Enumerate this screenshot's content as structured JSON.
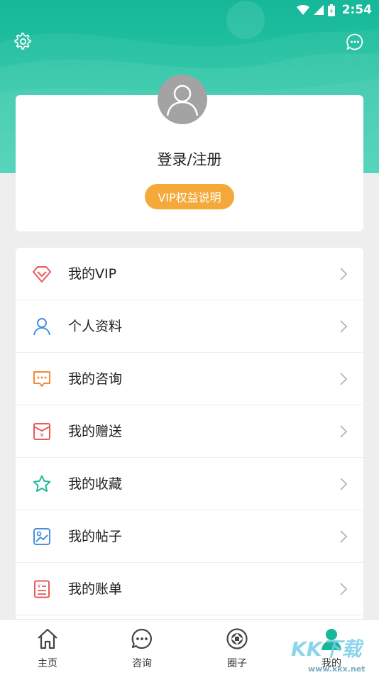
{
  "status_bar": {
    "time": "2:54"
  },
  "profile": {
    "login_label": "登录/注册",
    "vip_button": "VIP权益说明"
  },
  "menu": {
    "items": [
      {
        "label": "我的VIP",
        "icon": "diamond-icon",
        "color": "#e85a5a"
      },
      {
        "label": "个人资料",
        "icon": "person-icon",
        "color": "#4a90e2"
      },
      {
        "label": "我的咨询",
        "icon": "chat-icon",
        "color": "#f08c3c"
      },
      {
        "label": "我的赠送",
        "icon": "gift-envelope-icon",
        "color": "#e85a5a"
      },
      {
        "label": "我的收藏",
        "icon": "star-icon",
        "color": "#22b89a"
      },
      {
        "label": "我的帖子",
        "icon": "image-post-icon",
        "color": "#4a90e2"
      },
      {
        "label": "我的账单",
        "icon": "bill-icon",
        "color": "#e85a5a"
      }
    ]
  },
  "tabbar": {
    "tabs": [
      {
        "label": "主页",
        "icon": "home-icon"
      },
      {
        "label": "咨询",
        "icon": "chat-bubble-icon"
      },
      {
        "label": "圈子",
        "icon": "circle-icon"
      },
      {
        "label": "我的",
        "icon": "user-icon",
        "active": true
      }
    ]
  },
  "watermark": {
    "text": "KK下载",
    "url": "www.kkx.net"
  },
  "colors": {
    "primary": "#16b899",
    "vip": "#f6a93b"
  }
}
